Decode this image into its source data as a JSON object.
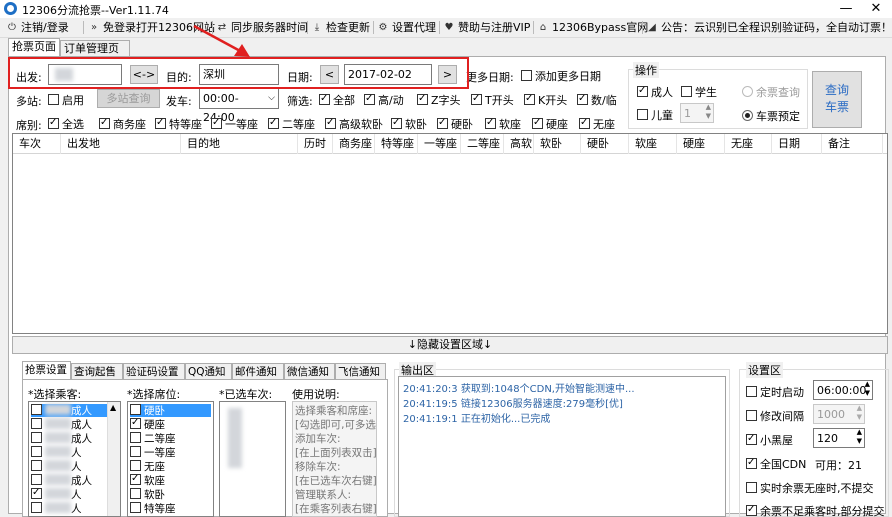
{
  "window": {
    "title": "12306分流抢票--Ver1.11.74",
    "minimize_glyph": "—",
    "close_glyph": "✕",
    "icon": "app-logo-icon"
  },
  "toolbar": {
    "items": [
      {
        "icon": "power-icon",
        "glyph": "⏻",
        "label": "注销/登录"
      },
      {
        "icon": "double-chevron-icon",
        "glyph": "»",
        "label": "免登录打开12306网站"
      },
      {
        "icon": "sync-icon",
        "glyph": "⇄",
        "label": "同步服务器时间"
      },
      {
        "icon": "download-icon",
        "glyph": "⤓",
        "label": "检查更新"
      },
      {
        "icon": "gear-icon",
        "glyph": "⚙",
        "label": "设置代理"
      },
      {
        "icon": "heart-icon",
        "glyph": "♥",
        "label": "赞助与注册VIP"
      },
      {
        "icon": "home-icon",
        "glyph": "⌂",
        "label": "12306Bypass官网"
      },
      {
        "icon": "megaphone-icon",
        "glyph": "◢",
        "label": "公告：云识别已全程识别验证码，全自动订票！"
      }
    ]
  },
  "tabs": {
    "grab": "抢票页面",
    "orders": "订单管理页面"
  },
  "search": {
    "from_label": "出发:",
    "from_value": "",
    "swap_label": "<->",
    "to_label": "目的:",
    "to_value": "深圳",
    "date_label": "日期:",
    "prev_label": "<",
    "date_value": "2017-02-02",
    "next_label": ">",
    "more_dates_label": "更多日期:",
    "add_more_dates_label": "添加更多日期"
  },
  "multistation": {
    "label": "多站:",
    "enable_label": "启用",
    "query_label": "多站查询",
    "depart_label": "发车:",
    "depart_value": "00:00-24:00"
  },
  "filter": {
    "label": "筛选:",
    "items": [
      {
        "label": "全部",
        "checked": true
      },
      {
        "label": "高/动",
        "checked": true
      },
      {
        "label": "Z字头",
        "checked": true
      },
      {
        "label": "T开头",
        "checked": true
      },
      {
        "label": "K开头",
        "checked": true
      },
      {
        "label": "数/临",
        "checked": true
      }
    ]
  },
  "seats": {
    "label": "席别:",
    "items": [
      {
        "label": "全选",
        "checked": true
      },
      {
        "label": "商务座",
        "checked": true
      },
      {
        "label": "特等座",
        "checked": true
      },
      {
        "label": "一等座",
        "checked": true
      },
      {
        "label": "二等座",
        "checked": true
      },
      {
        "label": "高级软卧",
        "checked": true
      },
      {
        "label": "软卧",
        "checked": true
      },
      {
        "label": "硬卧",
        "checked": true
      },
      {
        "label": "软座",
        "checked": true
      },
      {
        "label": "硬座",
        "checked": true
      },
      {
        "label": "无座",
        "checked": true
      }
    ]
  },
  "operation": {
    "title": "操作",
    "adult_label": "成人",
    "adult_checked": true,
    "student_label": "学生",
    "student_checked": false,
    "child_label": "儿童",
    "child_checked": false,
    "child_count": "1",
    "remaining_label": "余票查询",
    "reserve_label": "车票预定",
    "query_button": "查询\n车票"
  },
  "grid": {
    "columns": [
      "车次",
      "出发地",
      "目的地",
      "历时",
      "商务座",
      "特等座",
      "一等座",
      "二等座",
      "高软",
      "软卧",
      "硬卧",
      "软座",
      "硬座",
      "无座",
      "日期",
      "备注"
    ]
  },
  "hide_bar": "↓隐藏设置区域↓",
  "bottom_tabs": [
    "抢票设置",
    "查询起售",
    "验证码设置",
    "QQ通知",
    "邮件通知",
    "微信通知",
    "飞信通知"
  ],
  "passengers": {
    "label": "*选择乘客:",
    "items": [
      {
        "suffix": "成人",
        "checked": false,
        "selected": true
      },
      {
        "suffix": "成人",
        "checked": false,
        "selected": false
      },
      {
        "suffix": "成人",
        "checked": false,
        "selected": false
      },
      {
        "suffix": "人",
        "checked": false,
        "selected": false
      },
      {
        "suffix": "人",
        "checked": false,
        "selected": false
      },
      {
        "suffix": "成人",
        "checked": false,
        "selected": false
      },
      {
        "suffix": "人",
        "checked": true,
        "selected": false
      },
      {
        "suffix": "人",
        "checked": false,
        "selected": false
      }
    ]
  },
  "seat_pick": {
    "label": "*选择席位:",
    "items": [
      {
        "label": "硬卧",
        "checked": false,
        "selected": true
      },
      {
        "label": "硬座",
        "checked": true,
        "selected": false
      },
      {
        "label": "二等座",
        "checked": false,
        "selected": false
      },
      {
        "label": "一等座",
        "checked": false,
        "selected": false
      },
      {
        "label": "无座",
        "checked": false,
        "selected": false
      },
      {
        "label": "软座",
        "checked": true,
        "selected": false
      },
      {
        "label": "软卧",
        "checked": false,
        "selected": false
      },
      {
        "label": "特等座",
        "checked": false,
        "selected": false
      }
    ]
  },
  "selected_trains": {
    "label": "*已选车次:"
  },
  "usage": {
    "label": "使用说明:",
    "lines": [
      "选择乘客和席座:",
      "[勾选即可,可多选]",
      "添加车次:",
      "[在上面列表双击]",
      "移除车次:",
      "[在已选车次右键]",
      "管理联系人:",
      "[在乘客列表右键]"
    ]
  },
  "output": {
    "label": "输出区",
    "lines": [
      "20:41:20:3  获取到:1048个CDN,开始智能测速中...",
      "20:41:19:5  链接12306服务器速度:279毫秒[优]",
      "20:41:19:1  正在初始化...已完成"
    ]
  },
  "settings": {
    "title": "设置区",
    "timer_label": "定时启动",
    "timer_checked": false,
    "timer_value": "06:00:00",
    "interval_label": "修改间隔",
    "interval_checked": false,
    "interval_value": "1000",
    "blackroom_label": "小黑屋",
    "blackroom_checked": true,
    "blackroom_value": "120",
    "cdn_label": "全国CDN",
    "cdn_checked": true,
    "cdn_available": "可用：21",
    "realtime_label": "实时余票无座时,不提交",
    "realtime_checked": false,
    "partial_label": "余票不足乘客时,部分提交",
    "partial_checked": true
  },
  "colors": {
    "annotation_red": "#e02020",
    "log_blue": "#2d64a6",
    "selection_blue": "#3399ff"
  }
}
